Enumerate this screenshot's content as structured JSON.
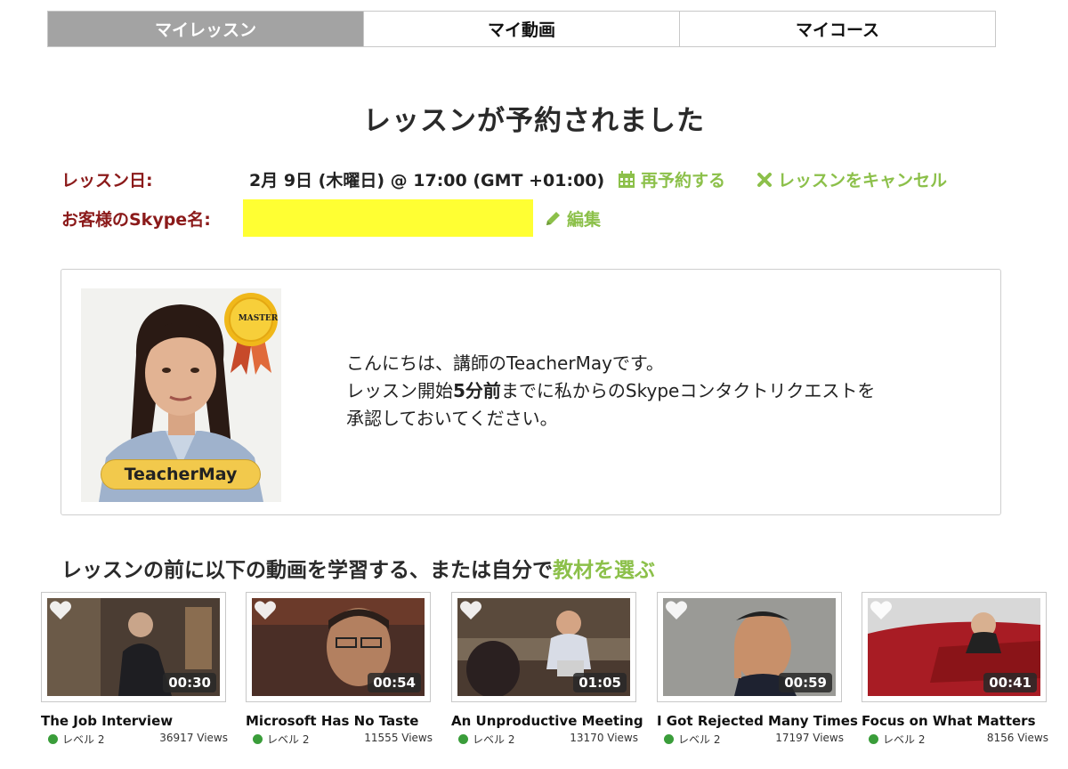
{
  "tabs": [
    {
      "label": "マイレッスン",
      "active": true
    },
    {
      "label": "マイ動画",
      "active": false
    },
    {
      "label": "マイコース",
      "active": false
    }
  ],
  "page_title": "レッスンが予約されました",
  "lesson": {
    "date_label": "レッスン日:",
    "date_value": "2月 9日 (木曜日) @ 17:00 (GMT +01:00)",
    "reschedule": "再予約する",
    "cancel": "レッスンをキャンセル",
    "skype_label": "お客様のSkype名:",
    "edit": "編集"
  },
  "teacher": {
    "name": "TeacherMay",
    "badge": "MASTER",
    "msg_line1": "こんにちは、講師のTeacherMayです。",
    "msg_line2_pre": "レッスン開始",
    "msg_line2_bold": "5分前",
    "msg_line2_post": "までに私からのSkypeコンタクトリクエストを",
    "msg_line3": "承認しておいてください。"
  },
  "section": {
    "heading": "レッスンの前に以下の動画を学習する、または自分で",
    "heading_link": "教材を選ぶ"
  },
  "videos": [
    {
      "title": "The Job Interview",
      "duration": "00:30",
      "level": "レベル 2",
      "views": "36917 Views"
    },
    {
      "title": "Microsoft Has No Taste",
      "duration": "00:54",
      "level": "レベル 2",
      "views": "11555 Views"
    },
    {
      "title": "An Unproductive Meeting",
      "duration": "01:05",
      "level": "レベル 2",
      "views": "13170 Views"
    },
    {
      "title": "I Got Rejected Many Times",
      "duration": "00:59",
      "level": "レベル 2",
      "views": "17197 Views"
    },
    {
      "title": "Focus on What Matters",
      "duration": "00:41",
      "level": "レベル 2",
      "views": "8156 Views"
    }
  ],
  "colors": {
    "accent_green": "#8cc04a",
    "label_red": "#8b1a1a",
    "active_tab": "#a3a3a3",
    "highlight": "#ffff33",
    "level_dot": "#3a9d3a",
    "badge_gold": "#f2c94c"
  }
}
